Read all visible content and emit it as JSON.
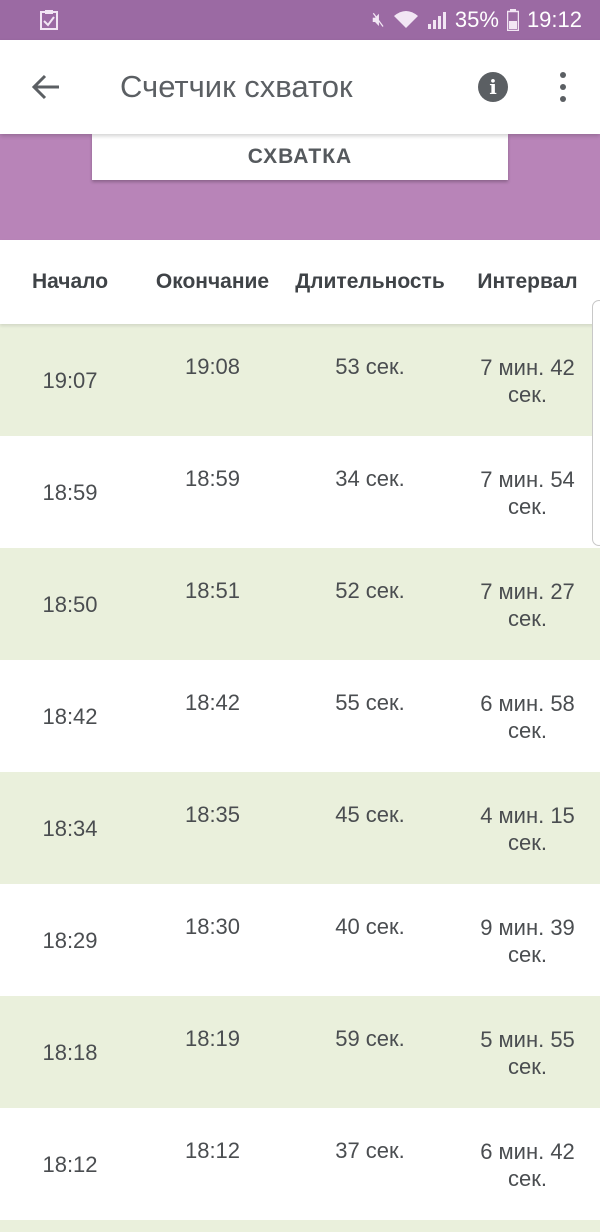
{
  "status_bar": {
    "battery_percent": "35%",
    "time": "19:12",
    "icons": [
      "checklist-notification-icon",
      "mute-icon",
      "wifi-icon",
      "signal-icon",
      "battery-icon"
    ]
  },
  "app_bar": {
    "title": "Счетчик схваток"
  },
  "contraction_button": {
    "label": "СХВАТКА"
  },
  "table": {
    "headers": {
      "start": "Начало",
      "end": "Окончание",
      "duration": "Длительность",
      "interval": "Интервал"
    },
    "rows": [
      {
        "start": "19:07",
        "end": "19:08",
        "duration": "53 сек.",
        "interval_min": "7 мин. 42",
        "interval_sec": "сек."
      },
      {
        "start": "18:59",
        "end": "18:59",
        "duration": "34 сек.",
        "interval_min": "7 мин. 54",
        "interval_sec": "сек."
      },
      {
        "start": "18:50",
        "end": "18:51",
        "duration": "52 сек.",
        "interval_min": "7 мин. 27",
        "interval_sec": "сек."
      },
      {
        "start": "18:42",
        "end": "18:42",
        "duration": "55 сек.",
        "interval_min": "6 мин. 58",
        "interval_sec": "сек."
      },
      {
        "start": "18:34",
        "end": "18:35",
        "duration": "45 сек.",
        "interval_min": "4 мин. 15",
        "interval_sec": "сек."
      },
      {
        "start": "18:29",
        "end": "18:30",
        "duration": "40 сек.",
        "interval_min": "9 мин. 39",
        "interval_sec": "сек."
      },
      {
        "start": "18:18",
        "end": "18:19",
        "duration": "59 сек.",
        "interval_min": "5 мин. 55",
        "interval_sec": "сек."
      },
      {
        "start": "18:12",
        "end": "18:12",
        "duration": "37 сек.",
        "interval_min": "6 мин. 42",
        "interval_sec": "сек."
      }
    ]
  },
  "colors": {
    "status_bar": "#9b6aa3",
    "band": "#b884b8",
    "alt_row": "#eaf0dc"
  }
}
